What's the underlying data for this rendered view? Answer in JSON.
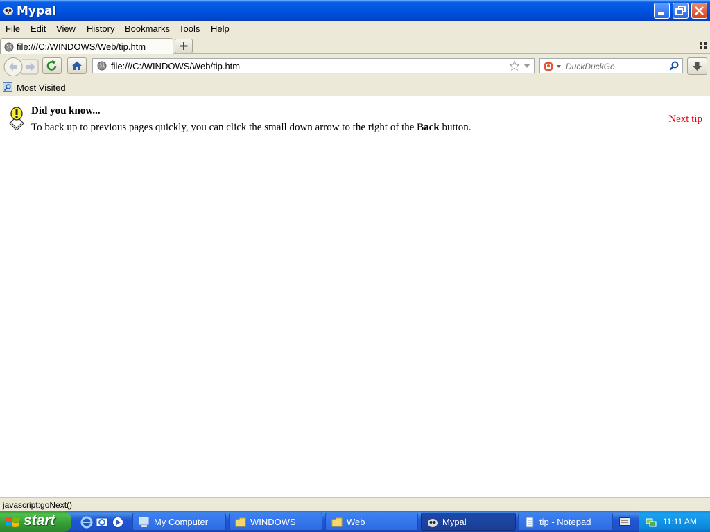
{
  "window": {
    "title": "Mypal"
  },
  "menu": [
    "File",
    "Edit",
    "View",
    "History",
    "Bookmarks",
    "Tools",
    "Help"
  ],
  "menu_accel": [
    "F",
    "E",
    "V",
    "s",
    "B",
    "T",
    "H"
  ],
  "tab": {
    "label": "file:///C:/WINDOWS/Web/tip.htm"
  },
  "navbar": {
    "url": "file:///C:/WINDOWS/Web/tip.htm",
    "search_placeholder": "DuckDuckGo"
  },
  "bookmarks": {
    "most_visited": "Most Visited"
  },
  "content": {
    "heading": "Did you know...",
    "body_before": "To back up to previous pages quickly, you can click the small down arrow to the right of the ",
    "body_bold": "Back",
    "body_after": " button.",
    "next_tip": "Next tip"
  },
  "status": "javascript:goNext()",
  "taskbar": {
    "start": "start",
    "tasks": [
      "My Computer",
      "WINDOWS",
      "Web",
      "Mypal",
      "tip - Notepad"
    ],
    "active_task": "Mypal",
    "clock": "11:11 AM"
  },
  "colors": {
    "link": "#e5000b",
    "title_bar": "#0054e3",
    "taskbar": "#2157d7",
    "start_button": "#37a037"
  }
}
